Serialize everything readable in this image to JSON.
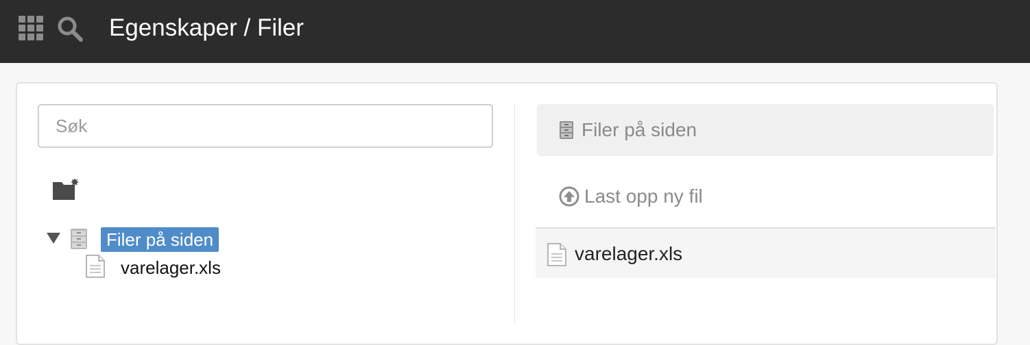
{
  "header": {
    "title": "Egenskaper / Filer",
    "apps_icon": "grid-icon",
    "search_icon": "search-icon"
  },
  "left": {
    "search": {
      "placeholder": "Søk",
      "value": ""
    },
    "new_folder_icon": "new-folder-icon",
    "tree": {
      "root": {
        "label": "Filer på siden",
        "expanded": true,
        "selected": true,
        "icon": "file-cabinet-icon"
      },
      "children": [
        {
          "label": "varelager.xls",
          "icon": "document-icon"
        }
      ]
    }
  },
  "right": {
    "header_label": "Filer på siden",
    "upload_label": "Last opp ny fil",
    "files": [
      {
        "name": "varelager.xls",
        "icon": "document-icon"
      }
    ]
  },
  "colors": {
    "topbar": "#2c2c2c",
    "selection": "#4f8cc9",
    "muted_text": "#8a8a8a"
  }
}
